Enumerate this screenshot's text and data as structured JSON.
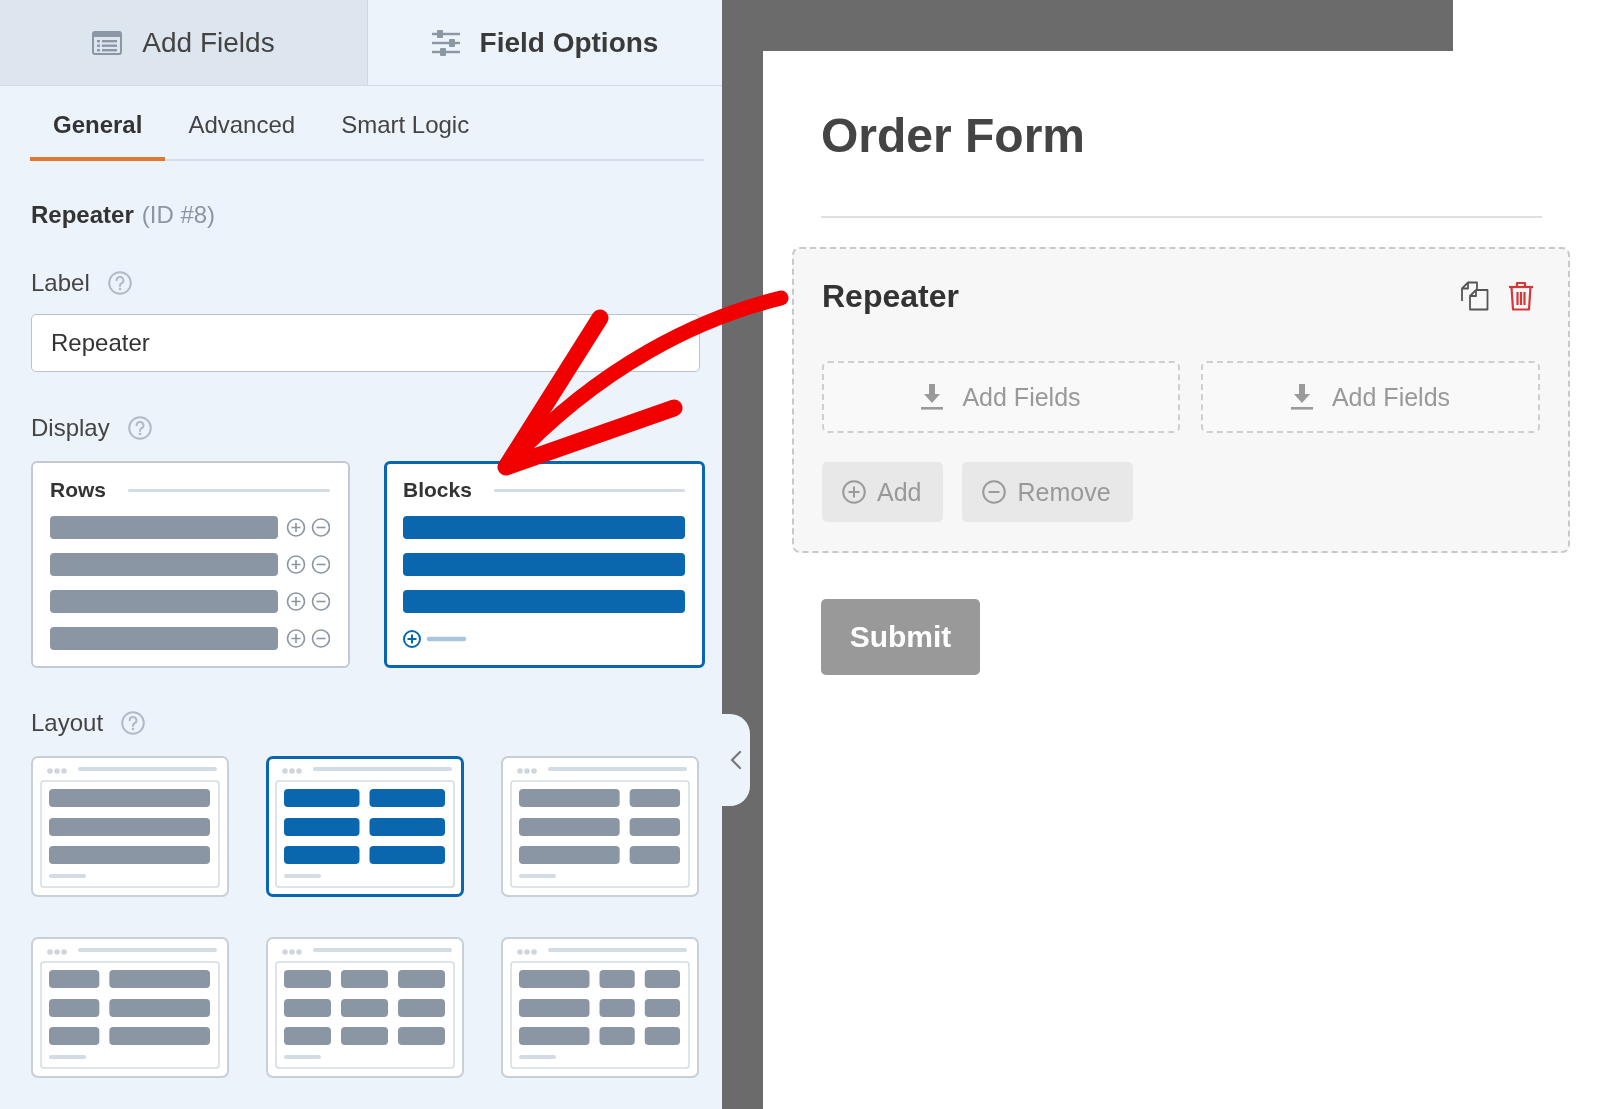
{
  "panel_tabs": [
    {
      "label": "Add Fields",
      "selected": false
    },
    {
      "label": "Field Options",
      "selected": true
    }
  ],
  "field_tabs": [
    {
      "label": "General",
      "selected": true
    },
    {
      "label": "Advanced",
      "selected": false
    },
    {
      "label": "Smart Logic",
      "selected": false
    }
  ],
  "field_title": {
    "name": "Repeater",
    "id_text": "(ID #8)"
  },
  "label_option": {
    "label": "Label",
    "value": "Repeater"
  },
  "display_option": {
    "label": "Display",
    "choices": [
      {
        "label": "Rows",
        "kind": "rows",
        "selected": false
      },
      {
        "label": "Blocks",
        "kind": "blocks",
        "selected": true
      }
    ]
  },
  "layout_option": {
    "label": "Layout",
    "choices": [
      {
        "kind": "one-column",
        "selected": false
      },
      {
        "kind": "two-equal",
        "selected": true
      },
      {
        "kind": "wide-narrow",
        "selected": false
      },
      {
        "kind": "narrow-wide",
        "selected": false
      },
      {
        "kind": "three-equal",
        "selected": false
      },
      {
        "kind": "wide-narrow-narrow",
        "selected": false
      }
    ]
  },
  "form": {
    "title": "Order Form",
    "repeater": {
      "title": "Repeater",
      "drop_zones": [
        {
          "label": "Add Fields"
        },
        {
          "label": "Add Fields"
        }
      ],
      "add_label": "Add",
      "remove_label": "Remove"
    },
    "submit_label": "Submit"
  }
}
